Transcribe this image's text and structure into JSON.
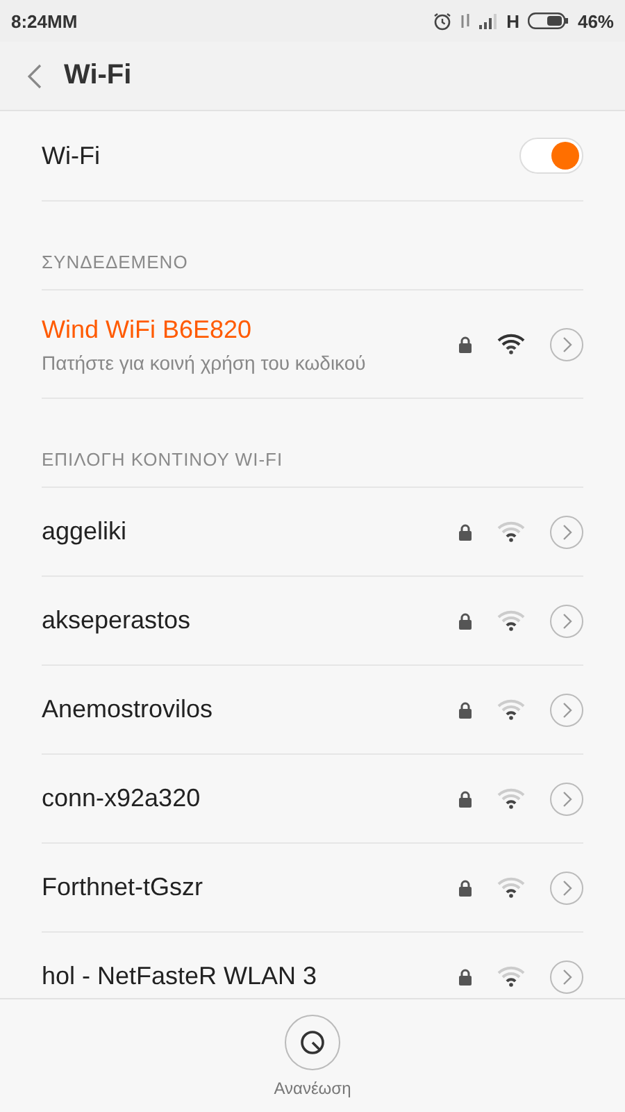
{
  "status_bar": {
    "time": "8:24MM",
    "network": "H",
    "battery": "46%"
  },
  "header": {
    "title": "Wi-Fi"
  },
  "wifi_toggle": {
    "label": "Wi-Fi",
    "on": true
  },
  "sections": [
    {
      "kind": "connected",
      "title": "ΣΥΝΔΕΔΕΜΕΝΟ",
      "networks": [
        {
          "name": "Wind WiFi B6E820",
          "subtitle": "Πατήστε για κοινή χρήση του κωδικού",
          "locked": true
        }
      ]
    },
    {
      "kind": "nearby",
      "title": "ΕΠΙΛΟΓΗ ΚΟΝΤΙΝΟΥ WI-FI",
      "networks": [
        {
          "name": "aggeliki",
          "locked": true
        },
        {
          "name": "akseperastos",
          "locked": true
        },
        {
          "name": "Anemostrovilos",
          "locked": true
        },
        {
          "name": "conn-x92a320",
          "locked": true
        },
        {
          "name": "Forthnet-tGszr",
          "locked": true
        },
        {
          "name": "hol - NetFasteR WLAN 3",
          "locked": true
        }
      ]
    }
  ],
  "refresh": {
    "label": "Ανανέωση"
  }
}
